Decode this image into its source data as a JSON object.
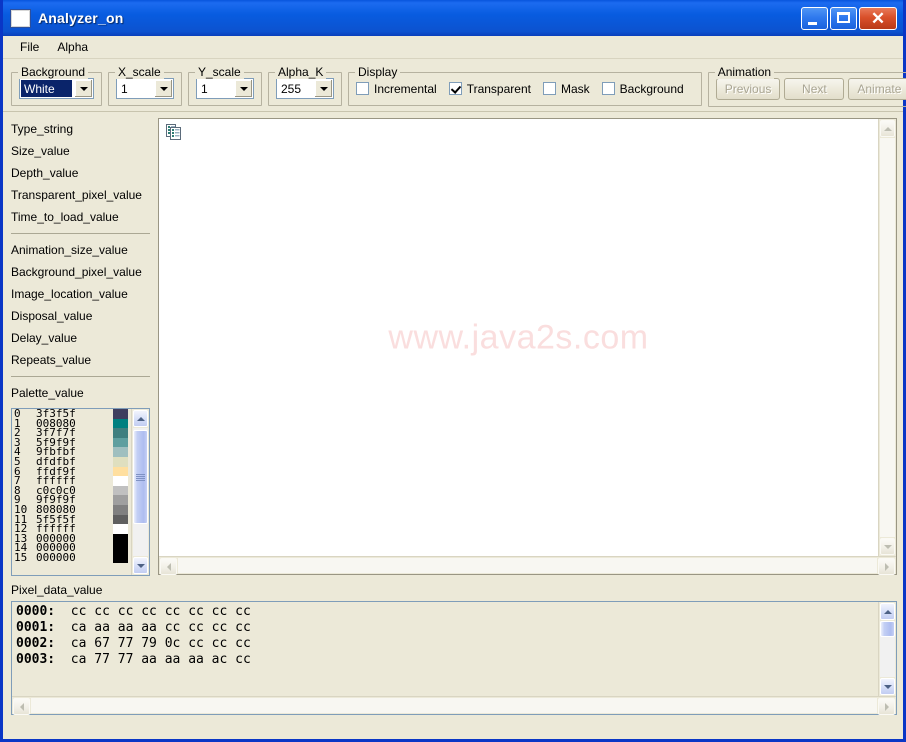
{
  "window": {
    "title": "Analyzer_on",
    "icon": "app-window-icon",
    "buttons": {
      "minimize": "minimize-icon",
      "maximize": "maximize-icon",
      "close": "close-icon"
    },
    "accent_titlebar": "#0a5ce0",
    "frame_color": "#0a36c6",
    "face_color": "#ece9d8"
  },
  "menubar": {
    "items": [
      {
        "label": "File"
      },
      {
        "label": "Alpha"
      }
    ]
  },
  "toolbar": {
    "background_group": {
      "title": "Background",
      "value": "White",
      "selected": true
    },
    "x_scale_group": {
      "title": "X_scale",
      "value": "1"
    },
    "y_scale_group": {
      "title": "Y_scale",
      "value": "1"
    },
    "alpha_k_group": {
      "title": "Alpha_K",
      "value": "255"
    },
    "display_group": {
      "title": "Display",
      "checkboxes": [
        {
          "label": "Incremental",
          "checked": false
        },
        {
          "label": "Transparent",
          "checked": true
        },
        {
          "label": "Mask",
          "checked": false
        },
        {
          "label": "Background",
          "checked": false
        }
      ]
    },
    "animation_group": {
      "title": "Animation",
      "buttons": [
        {
          "label": "Previous",
          "enabled": false
        },
        {
          "label": "Next",
          "enabled": false
        },
        {
          "label": "Animate",
          "enabled": false
        }
      ]
    }
  },
  "left_panel": {
    "group_one": [
      {
        "label": "Type_string"
      },
      {
        "label": "Size_value"
      },
      {
        "label": "Depth_value"
      },
      {
        "label": "Transparent_pixel_value"
      },
      {
        "label": "Time_to_load_value"
      }
    ],
    "group_two": [
      {
        "label": "Animation_size_value"
      },
      {
        "label": "Background_pixel_value"
      },
      {
        "label": "Image_location_value"
      },
      {
        "label": "Disposal_value"
      },
      {
        "label": "Delay_value"
      },
      {
        "label": "Repeats_value"
      }
    ],
    "palette_label": "Palette_value",
    "palette_rows": [
      {
        "index": "0",
        "hex": "3f3f5f",
        "color": "#3f3f5f"
      },
      {
        "index": "1",
        "hex": "008080",
        "color": "#008080"
      },
      {
        "index": "2",
        "hex": "3f7f7f",
        "color": "#3f7f7f"
      },
      {
        "index": "3",
        "hex": "5f9f9f",
        "color": "#5f9f9f"
      },
      {
        "index": "4",
        "hex": "9fbfbf",
        "color": "#9fbfbf"
      },
      {
        "index": "5",
        "hex": "dfdfbf",
        "color": "#dfdfbf"
      },
      {
        "index": "6",
        "hex": "ffdf9f",
        "color": "#ffdf9f"
      },
      {
        "index": "7",
        "hex": "ffffff",
        "color": "#ffffff"
      },
      {
        "index": "8",
        "hex": "c0c0c0",
        "color": "#c0c0c0"
      },
      {
        "index": "9",
        "hex": "9f9f9f",
        "color": "#9f9f9f"
      },
      {
        "index": "10",
        "hex": "808080",
        "color": "#808080"
      },
      {
        "index": "11",
        "hex": "5f5f5f",
        "color": "#5f5f5f"
      },
      {
        "index": "12",
        "hex": "ffffff",
        "color": "#ffffff"
      },
      {
        "index": "13",
        "hex": "000000",
        "color": "#000000"
      },
      {
        "index": "14",
        "hex": "000000",
        "color": "#000000"
      },
      {
        "index": "15",
        "hex": "000000",
        "color": "#000000"
      }
    ]
  },
  "canvas": {
    "watermark": "www.java2s.com",
    "doc_icon": "documents-icon",
    "h_scrollbar_enabled": false,
    "v_scrollbar_enabled": false
  },
  "pixel_data": {
    "label": "Pixel_data_value",
    "rows": [
      {
        "address": "0000:",
        "bytes": "cc cc cc cc cc cc cc cc"
      },
      {
        "address": "0001:",
        "bytes": "ca aa aa aa cc cc cc cc"
      },
      {
        "address": "0002:",
        "bytes": "ca 67 77 79 0c cc cc cc"
      },
      {
        "address": "0003:",
        "bytes": "ca 77 77 aa aa aa ac cc"
      }
    ]
  }
}
